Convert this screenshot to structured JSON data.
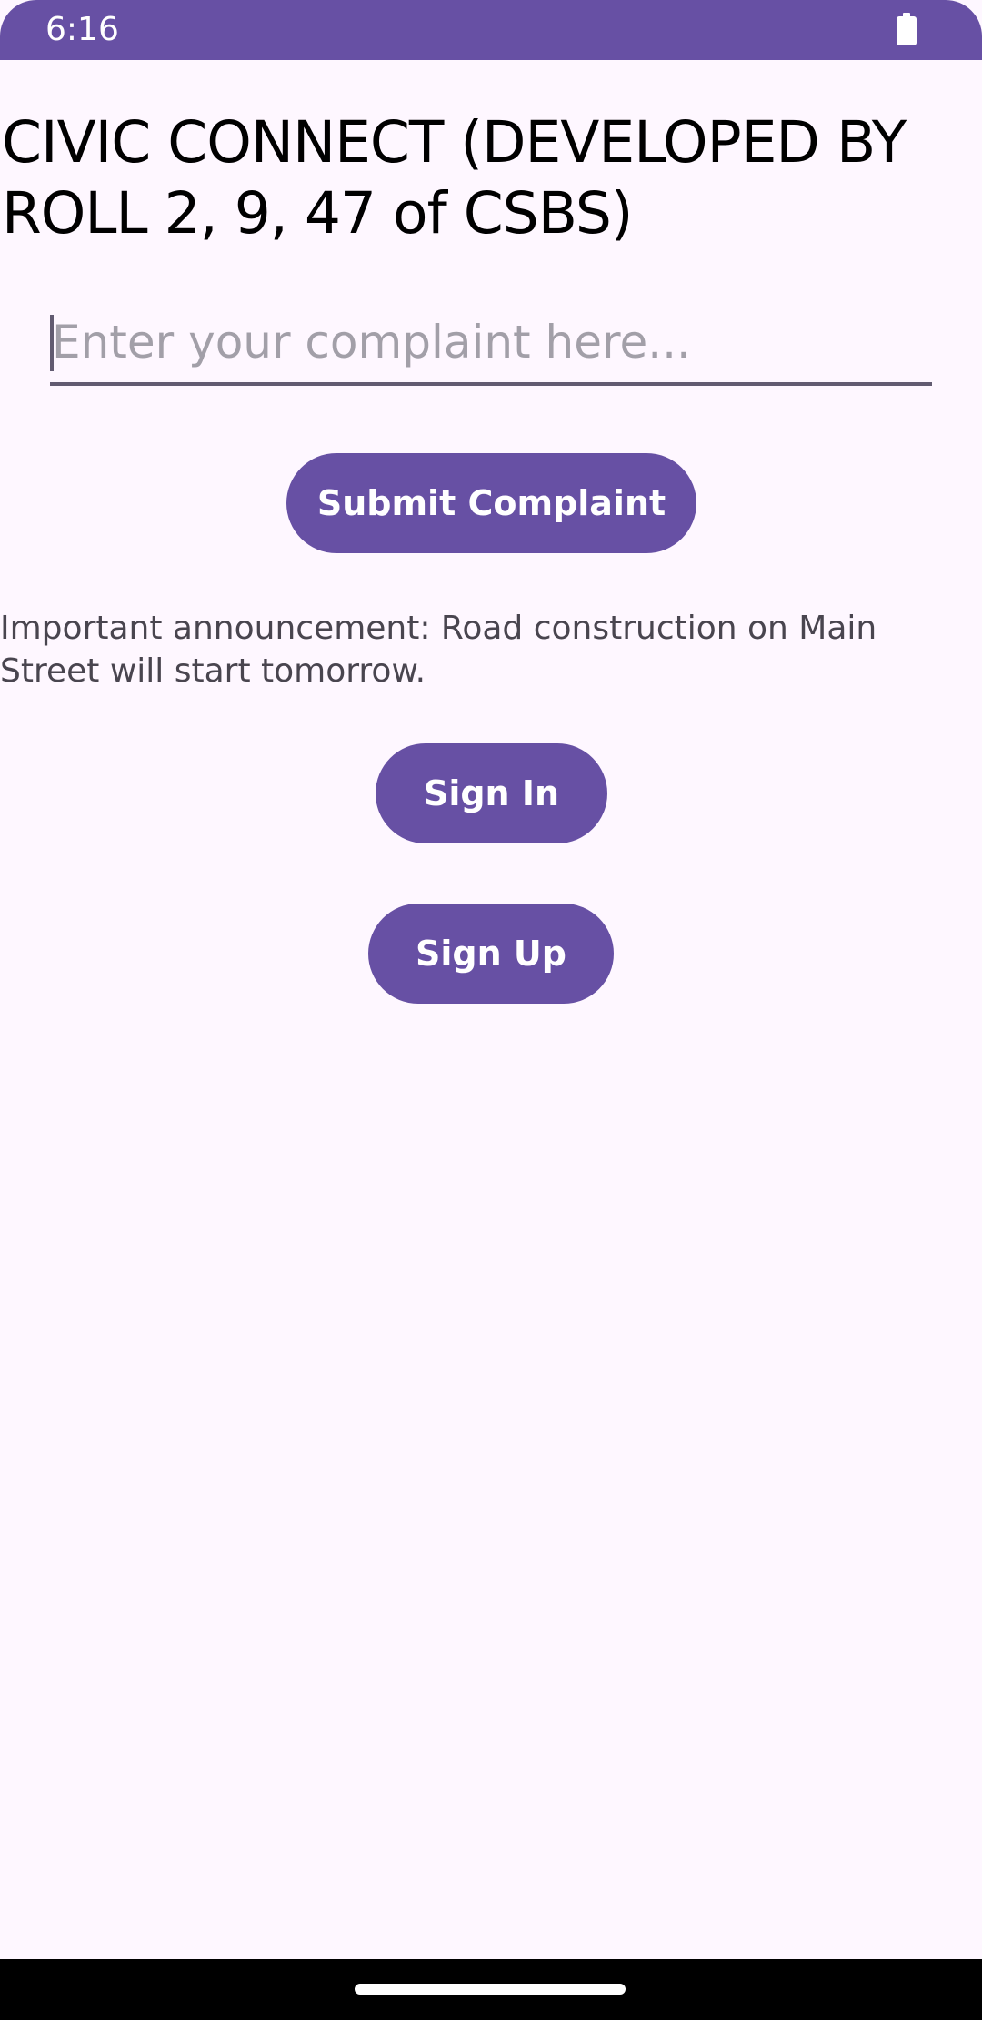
{
  "status_bar": {
    "time": "6:16",
    "battery_icon": "battery-full-icon",
    "color": "#6750A4"
  },
  "app": {
    "title": "CIVIC CONNECT (DEVELOPED BY ROLL 2, 9, 47 of CSBS)"
  },
  "complaint_input": {
    "value": "",
    "placeholder": "Enter your complaint here..."
  },
  "buttons": {
    "submit_label": "Submit Complaint",
    "sign_in_label": "Sign In",
    "sign_up_label": "Sign Up"
  },
  "announcement": {
    "text": "Important announcement: Road construction on Main Street will start tomorrow."
  },
  "theme": {
    "primary": "#6750A4",
    "background": "#FEF7FF",
    "on_surface_variant": "#49454F"
  }
}
